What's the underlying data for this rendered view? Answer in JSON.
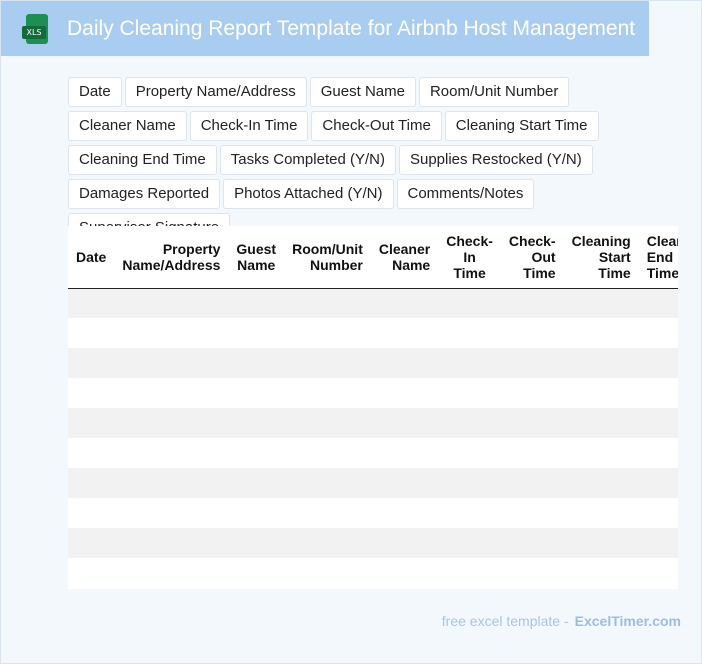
{
  "header": {
    "title": "Daily Cleaning Report Template for Airbnb Host Management",
    "icon": "xls-file-icon",
    "icon_label": "XLS",
    "background": "#a8cdf1"
  },
  "fields": [
    "Date",
    "Property Name/Address",
    "Guest Name",
    "Room/Unit Number",
    "Cleaner Name",
    "Check-In Time",
    "Check-Out Time",
    "Cleaning Start Time",
    "Cleaning End Time",
    "Tasks Completed (Y/N)",
    "Supplies Restocked (Y/N)",
    "Damages Reported",
    "Photos Attached (Y/N)",
    "Comments/Notes",
    "Supervisor Signature"
  ],
  "table": {
    "headers": [
      "Date",
      "Property Name/Address",
      "Guest Name",
      "Room/Unit Number",
      "Cleaner Name",
      "Check-In Time",
      "Check-Out Time",
      "Cleaning Start Time",
      "Cleaning End Time"
    ],
    "row_count": 10
  },
  "footer": {
    "text": "free excel template -",
    "brand": "ExcelTimer.com"
  }
}
